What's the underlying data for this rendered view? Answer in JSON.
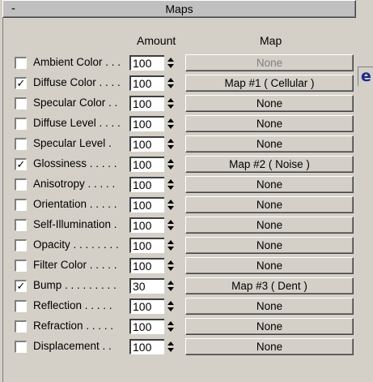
{
  "rollout": {
    "collapse_symbol": "-",
    "title": "Maps"
  },
  "headers": {
    "amount": "Amount",
    "map": "Map"
  },
  "edge_glyph": "e",
  "rows": [
    {
      "label": "Ambient Color . . .",
      "checked": false,
      "check_mark": "",
      "amount": "100",
      "map": "None",
      "disabled": true
    },
    {
      "label": "Diffuse Color . . . .",
      "checked": true,
      "check_mark": "✓",
      "amount": "100",
      "map": "Map #1  ( Cellular )",
      "disabled": false
    },
    {
      "label": "Specular Color  . .",
      "checked": false,
      "check_mark": "",
      "amount": "100",
      "map": "None",
      "disabled": false
    },
    {
      "label": "Diffuse Level . . . .",
      "checked": false,
      "check_mark": "",
      "amount": "100",
      "map": "None",
      "disabled": false
    },
    {
      "label": "Specular Level  .",
      "checked": false,
      "check_mark": "",
      "amount": "100",
      "map": "None",
      "disabled": false
    },
    {
      "label": "Glossiness  . . . . .",
      "checked": true,
      "check_mark": "✓",
      "amount": "100",
      "map": "Map #2  ( Noise )",
      "disabled": false
    },
    {
      "label": "Anisotropy  . . . . .",
      "checked": false,
      "check_mark": "",
      "amount": "100",
      "map": "None",
      "disabled": false
    },
    {
      "label": "Orientation . . . . .",
      "checked": false,
      "check_mark": "",
      "amount": "100",
      "map": "None",
      "disabled": false
    },
    {
      "label": "Self-Illumination .",
      "checked": false,
      "check_mark": "",
      "amount": "100",
      "map": "None",
      "disabled": false
    },
    {
      "label": "Opacity . . . . . . . .",
      "checked": false,
      "check_mark": "",
      "amount": "100",
      "map": "None",
      "disabled": false
    },
    {
      "label": "Filter Color  . . . . .",
      "checked": false,
      "check_mark": "",
      "amount": "100",
      "map": "None",
      "disabled": false
    },
    {
      "label": "Bump  . . . . . . . . .",
      "checked": true,
      "check_mark": "✓",
      "amount": "30",
      "map": "Map #3  ( Dent )",
      "disabled": false
    },
    {
      "label": "Reflection  . . . . .",
      "checked": false,
      "check_mark": "",
      "amount": "100",
      "map": "None",
      "disabled": false
    },
    {
      "label": "Refraction  . . . . .",
      "checked": false,
      "check_mark": "",
      "amount": "100",
      "map": "None",
      "disabled": false
    },
    {
      "label": "Displacement  . .",
      "checked": false,
      "check_mark": "",
      "amount": "100",
      "map": "None",
      "disabled": false
    }
  ]
}
